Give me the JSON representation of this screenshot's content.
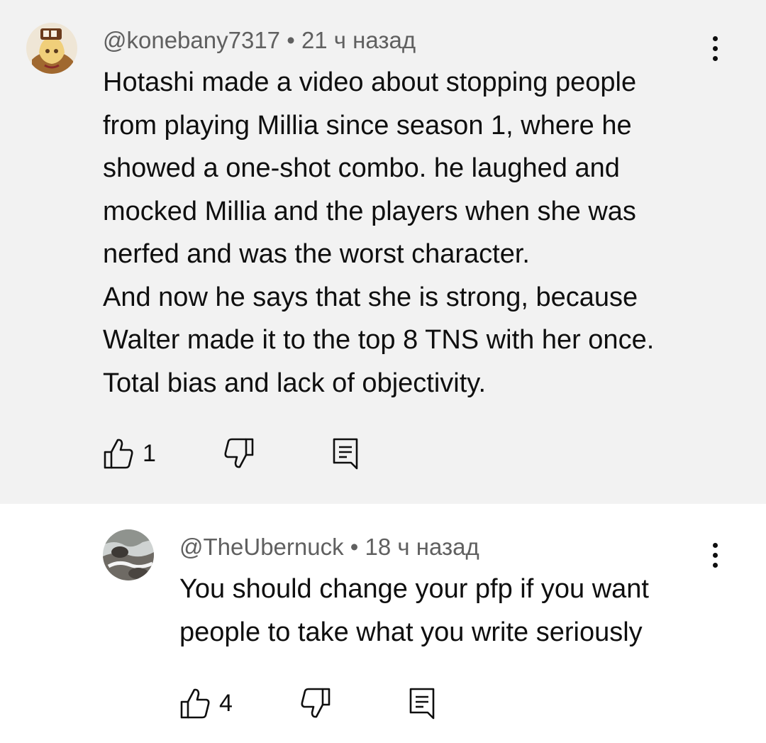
{
  "comments": [
    {
      "author": "@konebany7317",
      "separator": "•",
      "time": "21 ч назад",
      "text_lines": [
        "Hotashi made a video about stopping people",
        "from playing Millia since season 1, where he",
        "showed a one-shot combo. he laughed and",
        "mocked Millia and the players when she was",
        "nerfed and was the worst character.",
        "And now he says that she is strong, because",
        "Walter made it to the top 8 TNS with her once.",
        "Total bias and lack of objectivity."
      ],
      "likes": "1"
    },
    {
      "author": "@TheUbernuck",
      "separator": "•",
      "time": "18 ч назад",
      "text_lines": [
        "You should change your pfp if you want",
        "people to take what you write seriously"
      ],
      "likes": "4"
    }
  ],
  "icons": {
    "like": "thumb-up-icon",
    "dislike": "thumb-down-icon",
    "reply": "reply-comment-icon",
    "menu": "more-vert-icon"
  },
  "colors": {
    "parent_background": "#f2f2f2",
    "reply_background": "#ffffff",
    "meta_text": "#606060",
    "body_text": "#0f0f0f"
  }
}
